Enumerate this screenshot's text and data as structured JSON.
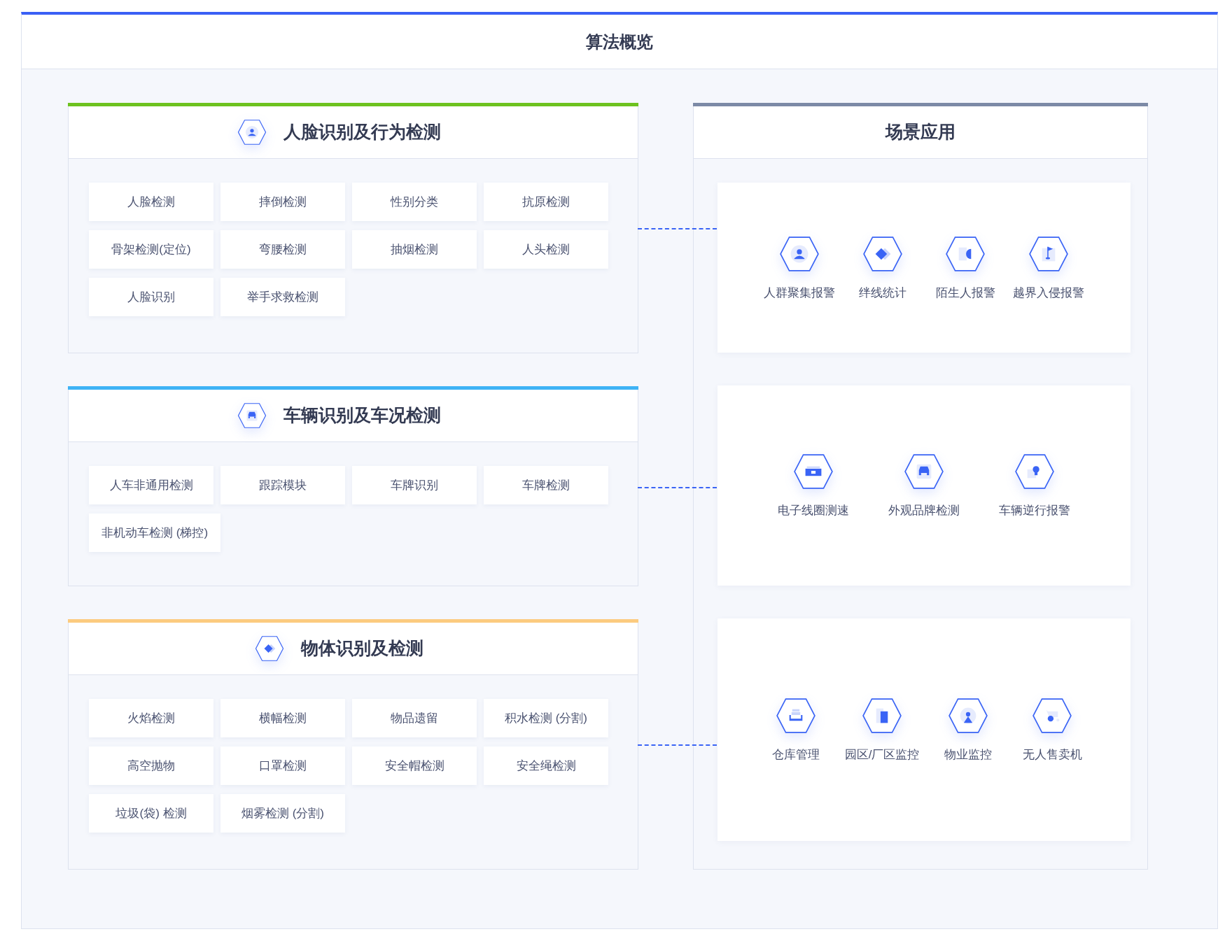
{
  "title": "算法概览",
  "groups": [
    {
      "title": "人脸识别及行为检测",
      "color": "#6dc21f",
      "items": [
        "人脸检测",
        "摔倒检测",
        "性别分类",
        "抗原检测",
        "骨架检测(定位)",
        "弯腰检测",
        "抽烟检测",
        "人头检测",
        "人脸识别",
        "举手求救检测"
      ]
    },
    {
      "title": "车辆识别及车况检测",
      "color": "#3fb3f5",
      "items": [
        "人车非通用检测",
        "跟踪模块",
        "车牌识别",
        "车牌检测",
        "非机动车检测 (梯控)"
      ]
    },
    {
      "title": "物体识别及检测",
      "color": "#fccb7f",
      "items": [
        "火焰检测",
        "横幅检测",
        "物品遗留",
        "积水检测 (分割)",
        "高空抛物",
        "口罩检测",
        "安全帽检测",
        "安全绳检测",
        "垃圾(袋) 检测",
        "烟雾检测 (分割)"
      ]
    }
  ],
  "scenes": {
    "title": "场景应用",
    "color": "#7c8aa6",
    "cards": [
      {
        "items": [
          "人群聚集报警",
          "绊线统计",
          "陌生人报警",
          "越界入侵报警"
        ]
      },
      {
        "items": [
          "电子线圈测速",
          "外观品牌检测",
          "车辆逆行报警"
        ]
      },
      {
        "items": [
          "仓库管理",
          "园区/厂区监控",
          "物业监控",
          "无人售卖机"
        ]
      }
    ]
  }
}
